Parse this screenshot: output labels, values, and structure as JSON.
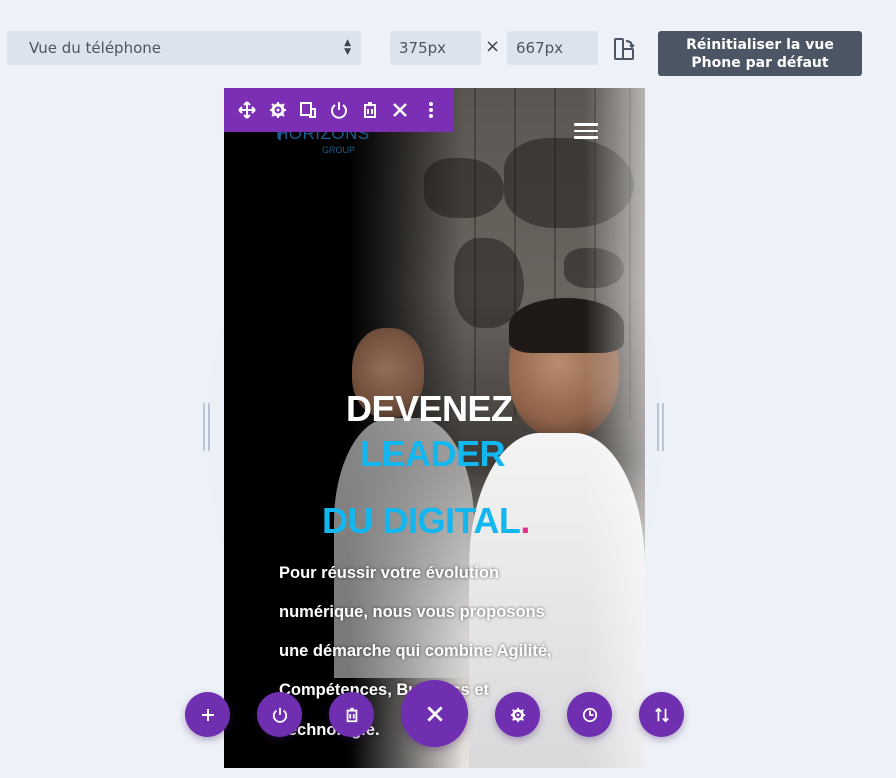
{
  "toolbar": {
    "view_select": "Vue du téléphone",
    "width_value": "375px",
    "height_value": "667px",
    "dimension_separator": "×",
    "reset_button_label": "Réinitialiser la vue Phone par défaut"
  },
  "module_toolbar": {
    "icons": [
      "move-icon",
      "gear-icon",
      "duplicate-icon",
      "power-icon",
      "trash-icon",
      "close-icon",
      "more-vertical-icon"
    ]
  },
  "preview": {
    "logo_main": "HORIZONS",
    "logo_sub": "GROUP",
    "headline_line1": "DEVENEZ",
    "headline_line2": "LEADER",
    "headline_line3": "DU DIGITAL",
    "headline_dot": ".",
    "body_lines": [
      "Pour réussir votre évolution",
      "numérique, nous vous proposons",
      "une démarche qui combine Agilité,",
      "Compétences, Business et",
      "Technologie."
    ]
  },
  "bottom_actions": {
    "items": [
      "add-icon",
      "power-icon",
      "trash-icon",
      "close-icon",
      "gear-icon",
      "history-icon",
      "sort-icon"
    ]
  },
  "colors": {
    "accent_purple": "#6f2fb0",
    "toolbar_purple": "#7b2fb5",
    "headline_cyan": "#12b7f0",
    "dot_pink": "#e0308a",
    "reset_button_bg": "#4b5563"
  }
}
